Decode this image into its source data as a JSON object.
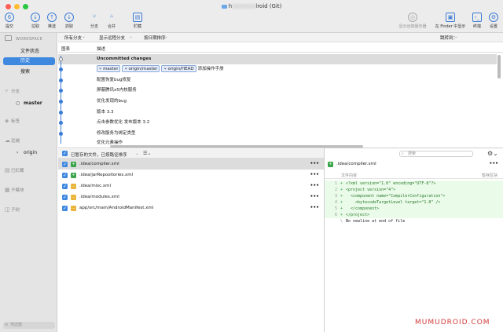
{
  "window": {
    "title_prefix": "h",
    "title_suffix": "lroid (Git)"
  },
  "toolbar": {
    "items": [
      {
        "label": "提交",
        "icon": "commit-icon",
        "badge": "6"
      },
      {
        "label": "拉取",
        "icon": "pull-icon"
      },
      {
        "label": "推送",
        "icon": "push-icon"
      },
      {
        "label": "抓取",
        "icon": "fetch-icon"
      },
      {
        "label": "分支",
        "icon": "branch-icon"
      },
      {
        "label": "合并",
        "icon": "merge-icon"
      },
      {
        "label": "贮藏",
        "icon": "stash-icon"
      }
    ],
    "right_items": [
      {
        "label": "显示远端服务器",
        "icon": "remote-icon"
      },
      {
        "label": "在 Finder 中显示",
        "icon": "finder-icon"
      },
      {
        "label": "终端",
        "icon": "terminal-icon"
      },
      {
        "label": "设置",
        "icon": "gear-icon"
      }
    ]
  },
  "sidebar": {
    "workspace_header": "WORKSPACE",
    "items": [
      "文件状态",
      "历史",
      "搜索"
    ],
    "active_index": 1,
    "sections": [
      {
        "label": "分支",
        "icon": "branch-icon",
        "children": [
          "master"
        ]
      },
      {
        "label": "标签",
        "icon": "tag-icon",
        "children": []
      },
      {
        "label": "远端",
        "icon": "cloud-icon",
        "children": [
          "origin"
        ]
      },
      {
        "label": "已贮藏",
        "icon": "stash-icon",
        "children": []
      },
      {
        "label": "子模块",
        "icon": "submodule-icon",
        "children": []
      },
      {
        "label": "子树",
        "icon": "subtree-icon",
        "children": []
      }
    ],
    "filter_placeholder": "筛选器"
  },
  "history_header": {
    "branch_filter": "所有分支",
    "remote_filter": "显示远程分支",
    "order": "按日期排序",
    "jump_label": "跳转到："
  },
  "columns": {
    "graph": "图表",
    "description": "描述"
  },
  "commits": [
    {
      "text": "Uncommitted changes",
      "bold": true,
      "tags": []
    },
    {
      "text": "添加操作手册",
      "tags": [
        "master",
        "origin/master",
        "origin/HEAD"
      ]
    },
    {
      "text": "配置恢复bug修复",
      "tags": []
    },
    {
      "text": "屏蔽腾讯x5内核服务",
      "tags": []
    },
    {
      "text": "优化发现的bug",
      "tags": []
    },
    {
      "text": "版本 3.3",
      "tags": []
    },
    {
      "text": "点击参数优化 发布版本 3.2",
      "tags": []
    },
    {
      "text": "修改服务为绑定类型",
      "tags": []
    },
    {
      "text": "优化元素操作",
      "tags": []
    }
  ],
  "files_pane": {
    "header": "已暂存的文件，已按路径排序",
    "files": [
      {
        "name": ".idea/compiler.xml",
        "status": "added",
        "selected": true
      },
      {
        "name": ".idea/jarRepositories.xml",
        "status": "added"
      },
      {
        "name": ".idea/misc.xml",
        "status": "modified"
      },
      {
        "name": ".idea/modules.xml",
        "status": "modified"
      },
      {
        "name": "app/src/main/AndroidManifest.xml",
        "status": "modified"
      }
    ]
  },
  "search": {
    "placeholder": "搜索"
  },
  "diff": {
    "file": ".idea/compiler.xml",
    "hunk_label": "文件内容",
    "action": "暂存区块",
    "lines": [
      {
        "n": "1",
        "sign": "+",
        "code": "<?xml version=\"1.0\" encoding=\"UTF-8\"?>",
        "type": "add"
      },
      {
        "n": "2",
        "sign": "+",
        "code": "<project version=\"4\">",
        "type": "add"
      },
      {
        "n": "3",
        "sign": "+",
        "code": "  <component name=\"CompilerConfiguration\">",
        "type": "add"
      },
      {
        "n": "4",
        "sign": "+",
        "code": "    <bytecodeTargetLevel target=\"1.8\" />",
        "type": "add"
      },
      {
        "n": "5",
        "sign": "+",
        "code": "  </component>",
        "type": "add"
      },
      {
        "n": "6",
        "sign": "+",
        "code": "</project>",
        "type": "add"
      },
      {
        "n": "",
        "sign": "\\",
        "code": "No newline at end of file",
        "type": "plain"
      }
    ]
  },
  "watermark": "MUMUDROID.COM",
  "colors": {
    "accent": "#3f88e0",
    "added": "#3aa54a",
    "modified": "#e8b43a"
  }
}
